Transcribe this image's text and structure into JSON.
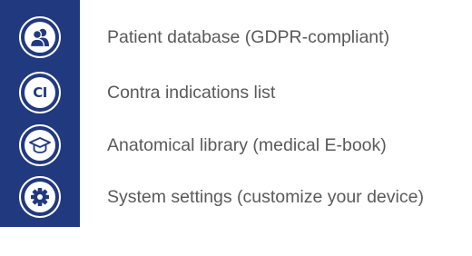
{
  "menu": {
    "items": [
      {
        "icon": "patients-icon",
        "label": "Patient database (GDPR-compliant)"
      },
      {
        "icon": "ci-icon",
        "icon_text": "CI",
        "label": "Contra indications list"
      },
      {
        "icon": "graduation-cap-icon",
        "label": "Anatomical library (medical E-book)"
      },
      {
        "icon": "gear-icon",
        "label": "System settings (customize your device)"
      }
    ]
  },
  "colors": {
    "sidebar_bg": "#21397f",
    "icon_fg": "#21397f",
    "label_text": "#5a5a5a"
  }
}
